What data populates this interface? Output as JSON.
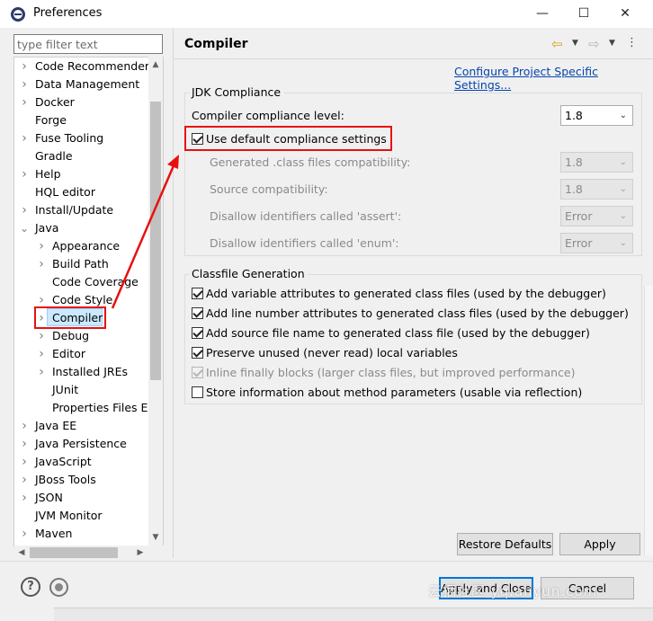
{
  "window": {
    "title": "Preferences",
    "minimize": "—",
    "maximize": "☐",
    "close": "✕"
  },
  "filter": {
    "placeholder": "type filter text"
  },
  "tree": {
    "items": [
      {
        "label": "Code Recommenders",
        "expandable": true,
        "depth": 0
      },
      {
        "label": "Data Management",
        "expandable": true,
        "depth": 0
      },
      {
        "label": "Docker",
        "expandable": true,
        "depth": 0
      },
      {
        "label": "Forge",
        "expandable": false,
        "depth": 0
      },
      {
        "label": "Fuse Tooling",
        "expandable": true,
        "depth": 0
      },
      {
        "label": "Gradle",
        "expandable": false,
        "depth": 0
      },
      {
        "label": "Help",
        "expandable": true,
        "depth": 0
      },
      {
        "label": "HQL editor",
        "expandable": false,
        "depth": 0
      },
      {
        "label": "Install/Update",
        "expandable": true,
        "depth": 0
      },
      {
        "label": "Java",
        "expandable": true,
        "expanded": true,
        "depth": 0
      },
      {
        "label": "Appearance",
        "expandable": true,
        "depth": 1
      },
      {
        "label": "Build Path",
        "expandable": true,
        "depth": 1
      },
      {
        "label": "Code Coverage",
        "expandable": false,
        "depth": 1
      },
      {
        "label": "Code Style",
        "expandable": true,
        "depth": 1
      },
      {
        "label": "Compiler",
        "expandable": true,
        "depth": 1,
        "selected": true
      },
      {
        "label": "Debug",
        "expandable": true,
        "depth": 1
      },
      {
        "label": "Editor",
        "expandable": true,
        "depth": 1
      },
      {
        "label": "Installed JREs",
        "expandable": true,
        "depth": 1
      },
      {
        "label": "JUnit",
        "expandable": false,
        "depth": 1
      },
      {
        "label": "Properties Files Ed",
        "expandable": false,
        "depth": 1
      },
      {
        "label": "Java EE",
        "expandable": true,
        "depth": 0
      },
      {
        "label": "Java Persistence",
        "expandable": true,
        "depth": 0
      },
      {
        "label": "JavaScript",
        "expandable": true,
        "depth": 0
      },
      {
        "label": "JBoss Tools",
        "expandable": true,
        "depth": 0
      },
      {
        "label": "JSON",
        "expandable": true,
        "depth": 0
      },
      {
        "label": "JVM Monitor",
        "expandable": false,
        "depth": 0
      },
      {
        "label": "Maven",
        "expandable": true,
        "depth": 0
      }
    ]
  },
  "page": {
    "title": "Compiler",
    "config_link": "Configure Project Specific Settings...",
    "jdk": {
      "group_title": "JDK Compliance",
      "level_label": "Compiler compliance level:",
      "level_value": "1.8",
      "use_default_label": "Use default compliance settings",
      "use_default_checked": true,
      "generated_label": "Generated .class files compatibility:",
      "generated_value": "1.8",
      "source_label": "Source compatibility:",
      "source_value": "1.8",
      "assert_label": "Disallow identifiers called 'assert':",
      "assert_value": "Error",
      "enum_label": "Disallow identifiers called 'enum':",
      "enum_value": "Error"
    },
    "classfile": {
      "group_title": "Classfile Generation",
      "options": [
        {
          "label": "Add variable attributes to generated class files (used by the debugger)",
          "checked": true,
          "enabled": true
        },
        {
          "label": "Add line number attributes to generated class files (used by the debugger)",
          "checked": true,
          "enabled": true
        },
        {
          "label": "Add source file name to generated class file (used by the debugger)",
          "checked": true,
          "enabled": true
        },
        {
          "label": "Preserve unused (never read) local variables",
          "checked": true,
          "enabled": true
        },
        {
          "label": "Inline finally blocks (larger class files, but improved performance)",
          "checked": true,
          "enabled": false
        },
        {
          "label": "Store information about method parameters (usable via reflection)",
          "checked": false,
          "enabled": true
        }
      ]
    },
    "restore_defaults": "Restore Defaults",
    "apply": "Apply"
  },
  "footer": {
    "help": "?",
    "apply_close": "Apply and Close",
    "cancel": "Cancel"
  },
  "watermark": "云栖社区 yq.aliyun.com",
  "colors": {
    "annotation": "#e81010",
    "link": "#0645ad",
    "selection": "#cce8ff",
    "focus": "#0078d7"
  }
}
